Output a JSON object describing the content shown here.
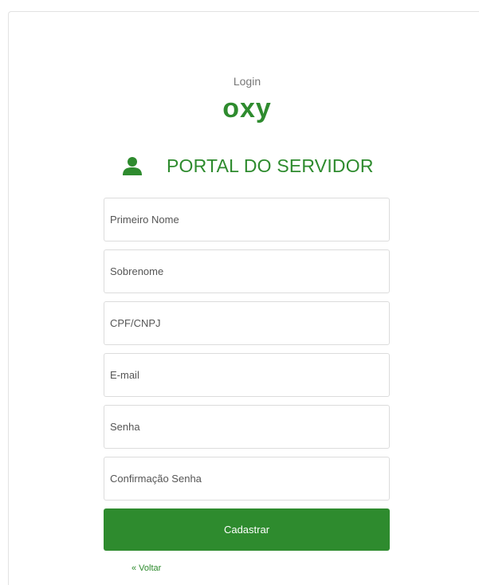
{
  "header": {
    "login_label": "Login",
    "logo_text": "oxy",
    "portal_title": "PORTAL DO SERVIDOR",
    "portal_icon": "user-icon"
  },
  "form": {
    "first_name_placeholder": "Primeiro Nome",
    "last_name_placeholder": "Sobrenome",
    "cpf_cnpj_placeholder": "CPF/CNPJ",
    "email_placeholder": "E-mail",
    "password_placeholder": "Senha",
    "confirm_password_placeholder": "Confirmação Senha",
    "submit_label": "Cadastrar"
  },
  "footer": {
    "back_label": "« Voltar"
  },
  "colors": {
    "brand_green": "#2e8b2e",
    "border": "#dcdcdc",
    "muted_text": "#777777"
  }
}
